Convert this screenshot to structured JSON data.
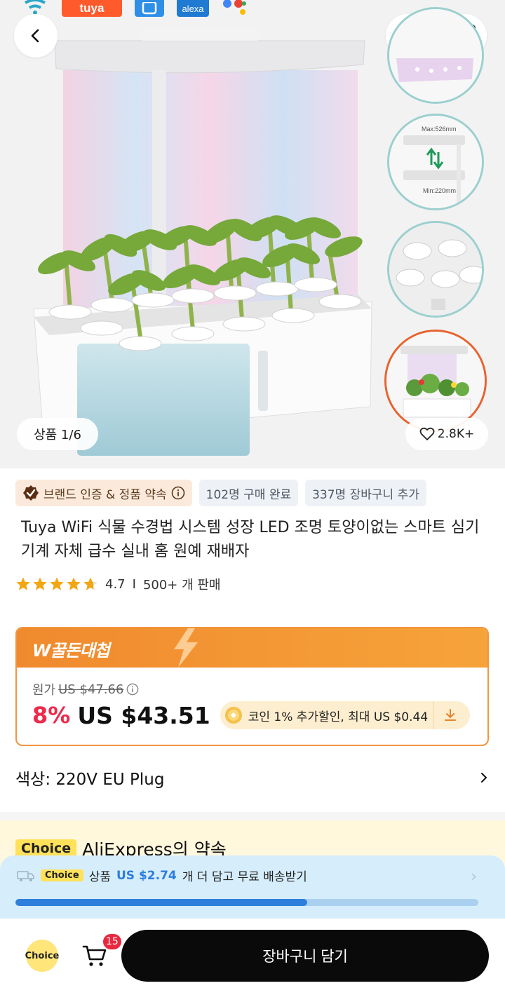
{
  "hero": {
    "logos": [
      "wifi-logo",
      "tuya",
      "smart-app-logo",
      "alexa",
      "google-assistant-logo"
    ],
    "logo_tuya": "tuya",
    "logo_alexa": "alexa",
    "counter": "상품 1/6",
    "favorites": "2.8K+",
    "thumbnail_labels": {
      "max": "Max:526mm",
      "min": "Min:220mm"
    }
  },
  "badges": {
    "brand": "브랜드 인증 & 정품 약속",
    "purchased": "102명 구매 완료",
    "carted": "337명 장바구니 추가"
  },
  "product": {
    "title": "Tuya WiFi 식물 수경법 시스템 성장 LED 조명 토양이없는 스마트 심기 기계 자체 급수 실내 홈 원예 재배자",
    "rating": "4.7",
    "rating_stars": 4.7,
    "separator": "I",
    "sold": "500+ 개 판매"
  },
  "price": {
    "deal_label": "W꿀돈대첩",
    "original_label": "원가",
    "original_price": "US $47.66",
    "discount": "8%",
    "current_price": "US $43.51",
    "coin_text": "코인 1% 추가할인, 최대 US $0.44"
  },
  "variant": {
    "color_label": "색상: 220V EU Plug"
  },
  "promise": {
    "choice_tag": "Choice",
    "title": "AliExpress의 약속"
  },
  "shipping": {
    "choice_tag": "Choice",
    "prefix": "상품",
    "amount": "US $2.74",
    "suffix": "개 더 담고 무료 배송받기",
    "progress": 0.63
  },
  "bottom": {
    "choice_label": "Choice",
    "cart_count": "15",
    "add_to_cart": "장바구니 담기"
  },
  "colors": {
    "accent_orange": "#f08a2e",
    "discount_red": "#ee2a4c",
    "progress_blue": "#2e7fdc",
    "choice_yellow": "#ffe15a"
  }
}
